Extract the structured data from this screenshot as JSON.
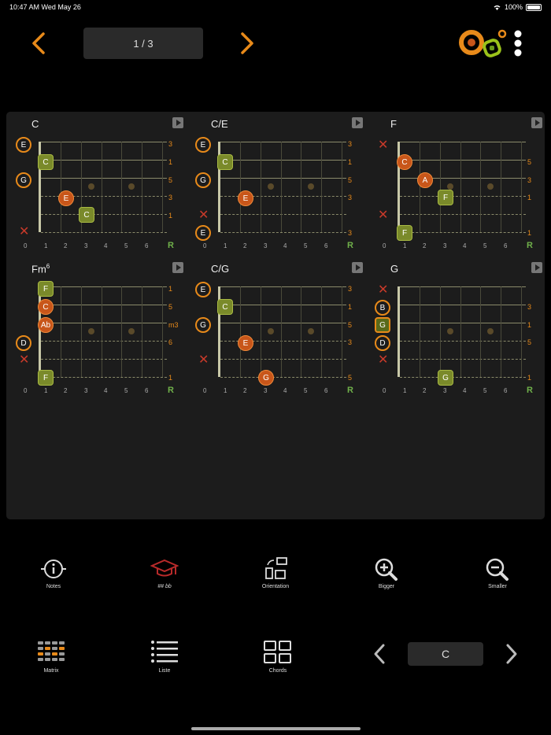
{
  "status": {
    "time": "10:47 AM  Wed May 26",
    "battery": "100%"
  },
  "header": {
    "page": "1 / 3"
  },
  "fret_numbers": [
    "0",
    "1",
    "2",
    "3",
    "4",
    "5",
    "6"
  ],
  "root_label": "R",
  "chords": [
    {
      "name": "C",
      "sup": "",
      "intervals": [
        "3",
        "1",
        "5",
        "3",
        "1",
        ""
      ]
    },
    {
      "name": "C/E",
      "sup": "",
      "intervals": [
        "3",
        "1",
        "5",
        "3",
        "",
        "3"
      ]
    },
    {
      "name": "F",
      "sup": "",
      "intervals": [
        "",
        "5",
        "3",
        "1",
        "",
        "1"
      ]
    },
    {
      "name": "Fm",
      "sup": "6",
      "intervals": [
        "1",
        "5",
        "m3",
        "6",
        "",
        "1"
      ]
    },
    {
      "name": "C/G",
      "sup": "",
      "intervals": [
        "3",
        "1",
        "5",
        "3",
        "",
        "5"
      ]
    },
    {
      "name": "G",
      "sup": "",
      "intervals": [
        "",
        "3",
        "1",
        "5",
        "",
        "1"
      ]
    }
  ],
  "notes": {
    "E": "E",
    "G": "G",
    "C": "C",
    "F": "F",
    "A": "A",
    "Ab": "Ab",
    "D": "D",
    "B": "B"
  },
  "toolbar": {
    "notes": "Notes",
    "accidentals": "##  bb",
    "orientation": "Orientation",
    "bigger": "Bigger",
    "smaller": "Smaller",
    "matrix": "Matrix",
    "liste": "Liste",
    "chords": "Chords"
  },
  "selector": {
    "value": "C"
  },
  "colors": {
    "accent": "#e88a1a",
    "root": "#6fb04a",
    "mute": "#c83a2a",
    "square": "#7a8a2a",
    "circle": "#c8561a"
  }
}
